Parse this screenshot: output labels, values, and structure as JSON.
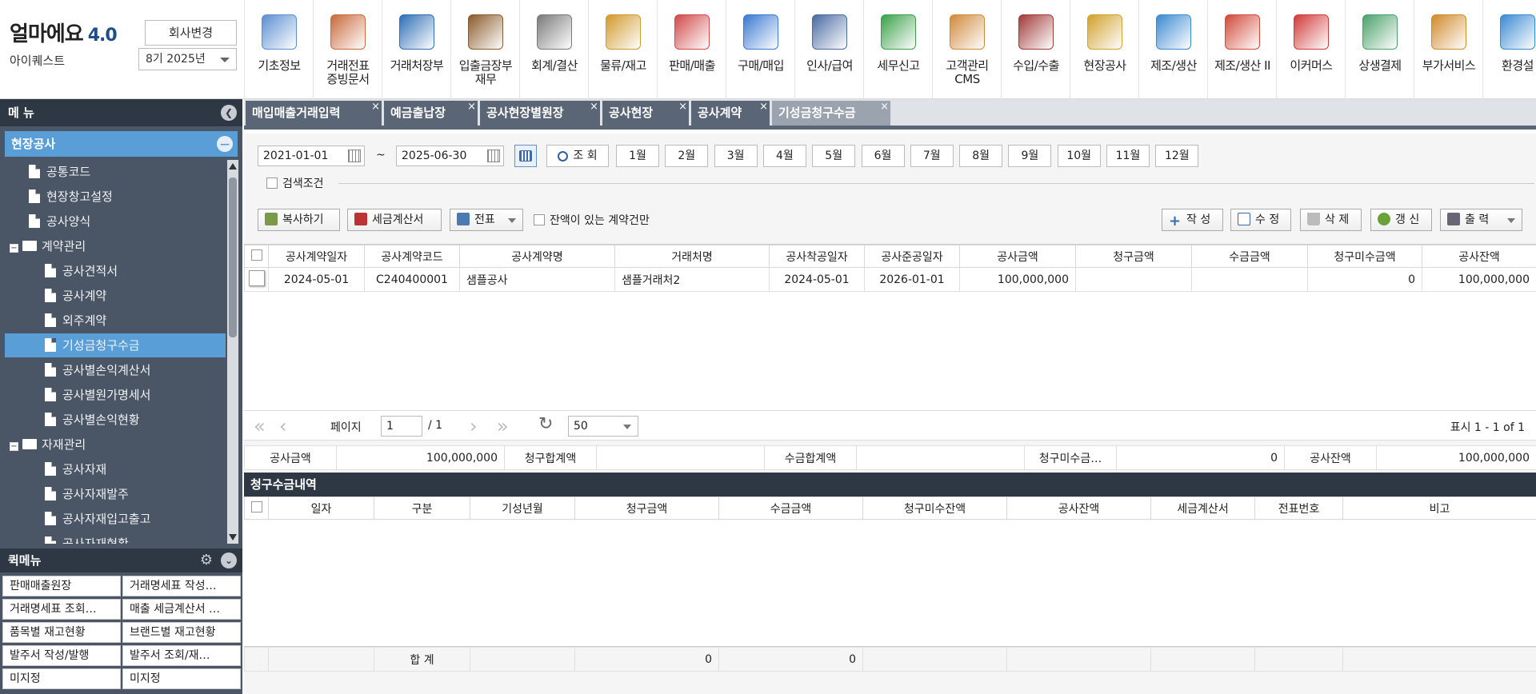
{
  "app": {
    "logo": "얼마에요",
    "version": "4.0",
    "company": "아이퀘스트",
    "change_company_label": "회사변경",
    "period": "8기 2025년"
  },
  "modules": [
    {
      "label": "기초정보",
      "icon": "basic-info-icon",
      "color": "#5b8fd1"
    },
    {
      "label": "거래전표\n증빙문서",
      "icon": "voucher-doc-icon",
      "color": "#c86a3a"
    },
    {
      "label": "거래처장부",
      "icon": "client-ledger-icon",
      "color": "#2e6fb7"
    },
    {
      "label": "입출금장부\n재무",
      "icon": "money-bag-icon",
      "color": "#8a5a2a"
    },
    {
      "label": "회계/결산",
      "icon": "accounting-icon",
      "color": "#7a7a7a"
    },
    {
      "label": "물류/재고",
      "icon": "logistics-cart-icon",
      "color": "#d19a2a"
    },
    {
      "label": "판매/매출",
      "icon": "sales-icon",
      "color": "#d14a4a"
    },
    {
      "label": "구매/매입",
      "icon": "purchase-icon",
      "color": "#3a7ad1"
    },
    {
      "label": "인사/급여",
      "icon": "hr-payroll-icon",
      "color": "#4a6aa1"
    },
    {
      "label": "세무신고",
      "icon": "tax-report-icon",
      "color": "#3aa14a"
    },
    {
      "label": "고객관리\nCMS",
      "icon": "customer-cms-icon",
      "color": "#d18a3a"
    },
    {
      "label": "수입/수출",
      "icon": "import-export-ship-icon",
      "color": "#a13a3a"
    },
    {
      "label": "현장공사",
      "icon": "construction-site-icon",
      "color": "#d1a12a"
    },
    {
      "label": "제조/생산",
      "icon": "manufacturing-icon",
      "color": "#3a8ad1"
    },
    {
      "label": "제조/생산 II",
      "icon": "factory-icon",
      "color": "#d14a3a"
    },
    {
      "label": "이커머스",
      "icon": "ecommerce-shop-icon",
      "color": "#d13a3a"
    },
    {
      "label": "상생결제",
      "icon": "payment-icon",
      "color": "#4aa16a"
    },
    {
      "label": "부가서비스",
      "icon": "bank-service-icon",
      "color": "#d18a2a"
    },
    {
      "label": "환경설",
      "icon": "settings-gear-icon",
      "color": "#3a8ad1"
    }
  ],
  "sidebar": {
    "menu_title": "메 뉴",
    "section": "현장공사",
    "tree": [
      {
        "label": "공통코드",
        "type": "doc",
        "level": 1
      },
      {
        "label": "현장창고설정",
        "type": "doc",
        "level": 1
      },
      {
        "label": "공사양식",
        "type": "doc",
        "level": 1
      },
      {
        "label": "계약관리",
        "type": "folder",
        "level": 0
      },
      {
        "label": "공사견적서",
        "type": "doc",
        "level": 2
      },
      {
        "label": "공사계약",
        "type": "doc",
        "level": 2
      },
      {
        "label": "외주계약",
        "type": "doc",
        "level": 2
      },
      {
        "label": "기성금청구수금",
        "type": "doc",
        "level": 2,
        "selected": true
      },
      {
        "label": "공사별손익계산서",
        "type": "doc",
        "level": 2
      },
      {
        "label": "공사별원가명세서",
        "type": "doc",
        "level": 2
      },
      {
        "label": "공사별손익현황",
        "type": "doc",
        "level": 2
      },
      {
        "label": "자재관리",
        "type": "folder",
        "level": 0
      },
      {
        "label": "공사자재",
        "type": "doc",
        "level": 2
      },
      {
        "label": "공사자재발주",
        "type": "doc",
        "level": 2
      },
      {
        "label": "공사자재입고출고",
        "type": "doc",
        "level": 2
      },
      {
        "label": "공사자재현황",
        "type": "doc",
        "level": 2
      }
    ],
    "quick_title": "퀵메뉴",
    "quick": [
      "판매매출원장",
      "거래명세표 작성…",
      "거래명세표 조회…",
      "매출 세금계산서 …",
      "품목별 재고현황",
      "브랜드별 재고현황",
      "발주서 작성/발행",
      "발주서 조회/재…",
      "미지정",
      "미지정"
    ]
  },
  "tabs": [
    {
      "label": "매입매출거래입력",
      "active": false
    },
    {
      "label": "예금출납장",
      "active": false
    },
    {
      "label": "공사현장별원장",
      "active": false
    },
    {
      "label": "공사현장",
      "active": false
    },
    {
      "label": "공사계약",
      "active": false
    },
    {
      "label": "기성금청구수금",
      "active": true
    }
  ],
  "search": {
    "date_from": "2021-01-01",
    "tilde": "~",
    "date_to": "2025-06-30",
    "search_label": "조 회",
    "months": [
      "1월",
      "2월",
      "3월",
      "4월",
      "5월",
      "6월",
      "7월",
      "8월",
      "9월",
      "10월",
      "11월",
      "12월"
    ],
    "condition_label": "검색조건"
  },
  "toolbar": {
    "copy": "복사하기",
    "tax_invoice": "세금계산서",
    "voucher": "전표",
    "balance_only": "잔액이 있는 계약건만",
    "create": "작 성",
    "edit": "수 정",
    "delete": "삭 제",
    "refresh": "갱 신",
    "print": "출 력"
  },
  "contract_grid": {
    "headers": [
      "공사계약일자",
      "공사계약코드",
      "공사계약명",
      "거래처명",
      "공사착공일자",
      "공사준공일자",
      "공사금액",
      "청구금액",
      "수금금액",
      "청구미수금액",
      "공사잔액"
    ],
    "rows": [
      [
        "2024-05-01",
        "C240400001",
        "샘플공사",
        "샘플거래처2",
        "2024-05-01",
        "2026-01-01",
        "100,000,000",
        "",
        "",
        "0",
        "100,000,000"
      ]
    ]
  },
  "pager": {
    "page_label": "페이지",
    "page": "1",
    "total": "/ 1",
    "page_size": "50",
    "display": "표시 1 - 1 of 1"
  },
  "summary": [
    {
      "label": "공사금액",
      "value": "100,000,000"
    },
    {
      "label": "청구합계액",
      "value": ""
    },
    {
      "label": "수금합계액",
      "value": ""
    },
    {
      "label": "청구미수금…",
      "value": "0"
    },
    {
      "label": "공사잔액",
      "value": "100,000,000"
    }
  ],
  "claim_grid": {
    "title": "청구수금내역",
    "headers": [
      "일자",
      "구분",
      "기성년월",
      "청구금액",
      "수금금액",
      "청구미수잔액",
      "공사잔액",
      "세금계산서",
      "전표번호",
      "비고"
    ],
    "total_label": "합 계",
    "totals": [
      "",
      "",
      "",
      "0",
      "0",
      "",
      "",
      "",
      "",
      ""
    ]
  }
}
